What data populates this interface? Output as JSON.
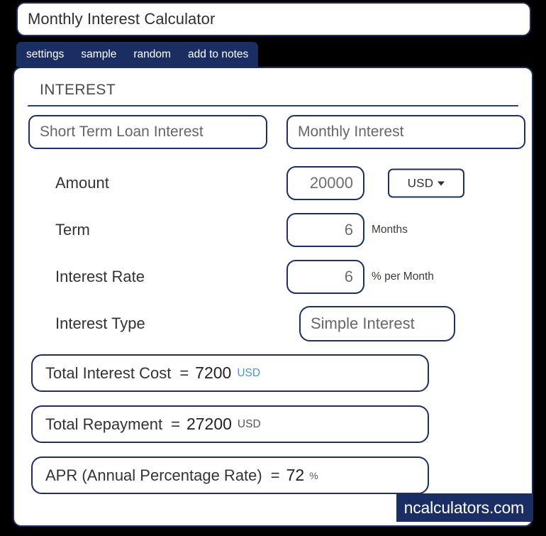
{
  "window": {
    "title": "Monthly Interest Calculator"
  },
  "tabs": [
    {
      "label": "settings"
    },
    {
      "label": "sample"
    },
    {
      "label": "random"
    },
    {
      "label": "add to notes"
    }
  ],
  "section": {
    "header": "INTEREST"
  },
  "categories": {
    "primary": "Short Term Loan Interest",
    "secondary": "Monthly Interest"
  },
  "form": {
    "amount": {
      "label": "Amount",
      "value": "20000",
      "currency": "USD",
      "currency_icon": "chevron-down-icon"
    },
    "term": {
      "label": "Term",
      "value": "6",
      "unit": "Months"
    },
    "interest_rate": {
      "label": "Interest Rate",
      "value": "6",
      "unit": "% per Month"
    },
    "interest_type": {
      "label": "Interest Type",
      "value": "Simple Interest"
    }
  },
  "results": [
    {
      "label": "Total Interest Cost",
      "equals": "=",
      "value": "7200",
      "unit": "USD"
    },
    {
      "label": "Total Repayment",
      "equals": "=",
      "value": "27200",
      "unit": "USD"
    },
    {
      "label": "APR (Annual Percentage Rate)",
      "equals": "=",
      "value": "72",
      "unit": "%"
    }
  ],
  "footer": {
    "brand": "ncalculators.com"
  },
  "colors": {
    "navy": "#1d3060",
    "tab_bar": "#1b2e63",
    "accent_link": "#4a90e2",
    "background": "#000000",
    "card": "#ffffff"
  }
}
